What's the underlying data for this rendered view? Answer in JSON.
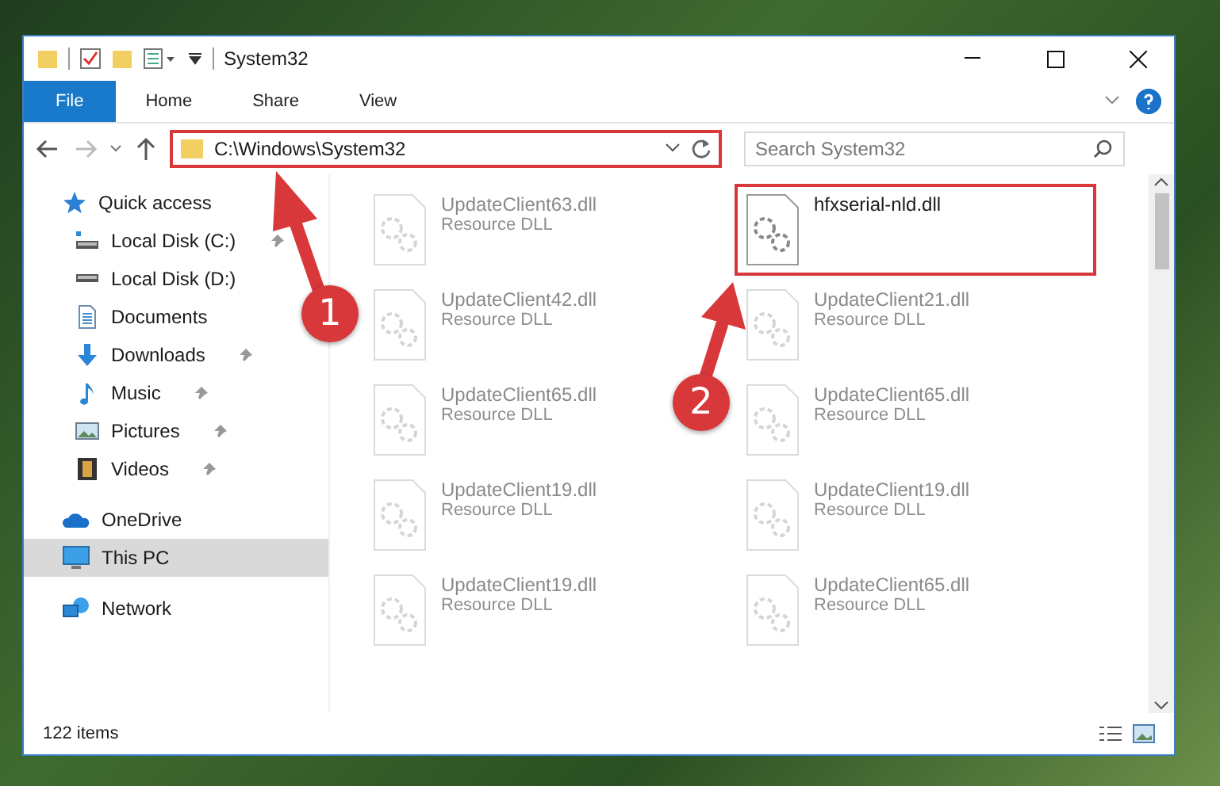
{
  "window": {
    "title": "System32"
  },
  "ribbon_tabs": [
    {
      "label": "File",
      "selected": true
    },
    {
      "label": "Home",
      "selected": false
    },
    {
      "label": "Share",
      "selected": false
    },
    {
      "label": "View",
      "selected": false
    }
  ],
  "address_bar": {
    "path": "C:\\Windows\\System32",
    "highlighted": true
  },
  "search": {
    "placeholder": "Search System32"
  },
  "sidebar": {
    "items": [
      {
        "label": "Quick access",
        "kind": "star",
        "pinned": false,
        "selected": false
      },
      {
        "label": "Local Disk (C:)",
        "kind": "drive-c",
        "pinned": true,
        "selected": false
      },
      {
        "label": "Local Disk (D:)",
        "kind": "drive",
        "pinned": false,
        "selected": false
      },
      {
        "label": "Documents",
        "kind": "documents",
        "pinned": false,
        "selected": false
      },
      {
        "label": "Downloads",
        "kind": "downloads",
        "pinned": true,
        "selected": false
      },
      {
        "label": "Music",
        "kind": "music",
        "pinned": true,
        "selected": false
      },
      {
        "label": "Pictures",
        "kind": "pictures",
        "pinned": true,
        "selected": false
      },
      {
        "label": "Videos",
        "kind": "videos",
        "pinned": true,
        "selected": false
      },
      {
        "label": "OneDrive",
        "kind": "cloud",
        "pinned": false,
        "selected": false
      },
      {
        "label": "This PC",
        "kind": "pc",
        "pinned": false,
        "selected": true
      },
      {
        "label": "Network",
        "kind": "network",
        "pinned": false,
        "selected": false
      }
    ]
  },
  "files": [
    {
      "name": "UpdateClient63.dll",
      "type": "Resource DLL",
      "faded": true,
      "highlighted": false
    },
    {
      "name": "hfxserial-nld.dll",
      "faded": false,
      "highlighted": true
    },
    {
      "name": "UpdateClient42.dll",
      "type": "Resource DLL",
      "faded": true,
      "highlighted": false
    },
    {
      "name": "UpdateClient21.dll",
      "type": "Resource DLL",
      "faded": true,
      "highlighted": false
    },
    {
      "name": "UpdateClient65.dll",
      "type": "Resource DLL",
      "faded": true,
      "highlighted": false
    },
    {
      "name": "UpdateClient65.dll",
      "type": "Resource DLL",
      "faded": true,
      "highlighted": false
    },
    {
      "name": "UpdateClient19.dll",
      "type": "Resource DLL",
      "faded": true,
      "highlighted": false
    },
    {
      "name": "UpdateClient19.dll",
      "type": "Resource DLL",
      "faded": true,
      "highlighted": false
    },
    {
      "name": "UpdateClient19.dll",
      "type": "Resource DLL",
      "faded": true,
      "highlighted": false
    },
    {
      "name": "UpdateClient65.dll",
      "type": "Resource DLL",
      "faded": true,
      "highlighted": false
    }
  ],
  "status_bar": {
    "item_count": "122 items"
  },
  "annotations": [
    {
      "number": "1"
    },
    {
      "number": "2"
    }
  ]
}
